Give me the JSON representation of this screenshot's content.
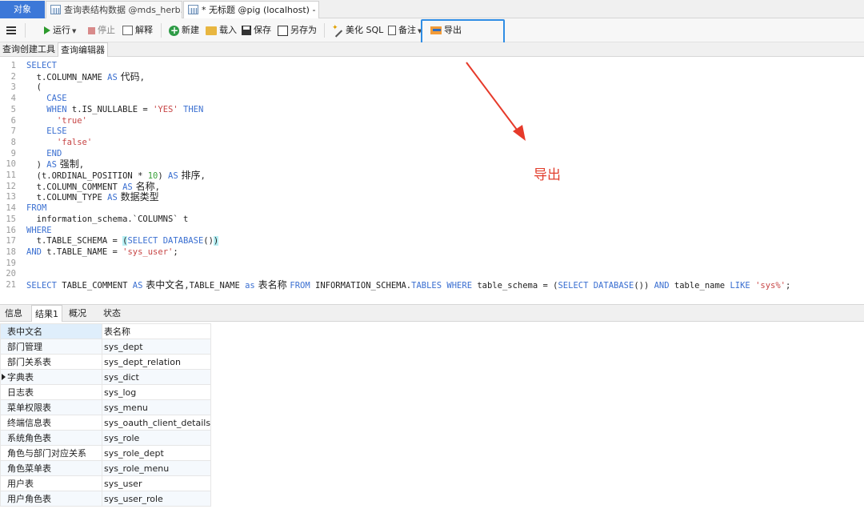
{
  "tabs": {
    "objects": "对象",
    "doc1": "查询表结构数据 @mds_herb...",
    "doc2": "* 无标题 @pig (localhost) - ..."
  },
  "toolbar": {
    "run": "运行",
    "stop": "停止",
    "explain": "解释",
    "new": "新建",
    "load": "载入",
    "save": "保存",
    "save_as": "另存为",
    "beautify": "美化 SQL",
    "note": "备注",
    "export": "导出"
  },
  "subtabs": [
    "查询创建工具",
    "查询编辑器"
  ],
  "annotation": {
    "text": "导出",
    "color": "#e2402f"
  },
  "result_tabs": [
    "信息",
    "结果1",
    "概况",
    "状态"
  ],
  "grid": {
    "columns": [
      "表中文名",
      "表名称"
    ],
    "rows": [
      [
        "部门管理",
        "sys_dept"
      ],
      [
        "部门关系表",
        "sys_dept_relation"
      ],
      [
        "字典表",
        "sys_dict"
      ],
      [
        "日志表",
        "sys_log"
      ],
      [
        "菜单权限表",
        "sys_menu"
      ],
      [
        "终端信息表",
        "sys_oauth_client_details"
      ],
      [
        "系统角色表",
        "sys_role"
      ],
      [
        "角色与部门对应关系",
        "sys_role_dept"
      ],
      [
        "角色菜单表",
        "sys_role_menu"
      ],
      [
        "用户表",
        "sys_user"
      ],
      [
        "用户角色表",
        "sys_user_role"
      ]
    ]
  },
  "editor": {
    "lines": [
      [
        [
          "kw",
          "SELECT"
        ]
      ],
      [
        [
          "t",
          "  t.COLUMN_NAME "
        ],
        [
          "kw",
          "AS"
        ],
        [
          "cjk",
          " 代码"
        ],
        [
          "t",
          ","
        ]
      ],
      [
        [
          "t",
          "  ("
        ]
      ],
      [
        [
          "t",
          "    "
        ],
        [
          "kw",
          "CASE"
        ]
      ],
      [
        [
          "t",
          "    "
        ],
        [
          "kw",
          "WHEN"
        ],
        [
          "t",
          " t.IS_NULLABLE = "
        ],
        [
          "str",
          "'YES'"
        ],
        [
          "t",
          " "
        ],
        [
          "kw",
          "THEN"
        ]
      ],
      [
        [
          "t",
          "      "
        ],
        [
          "str",
          "'true'"
        ]
      ],
      [
        [
          "t",
          "    "
        ],
        [
          "kw",
          "ELSE"
        ]
      ],
      [
        [
          "t",
          "      "
        ],
        [
          "str",
          "'false'"
        ]
      ],
      [
        [
          "t",
          "    "
        ],
        [
          "kw",
          "END"
        ]
      ],
      [
        [
          "t",
          "  ) "
        ],
        [
          "kw",
          "AS"
        ],
        [
          "cjk",
          " 强制"
        ],
        [
          "t",
          ","
        ]
      ],
      [
        [
          "t",
          "  (t.ORDINAL_POSITION * "
        ],
        [
          "num",
          "10"
        ],
        [
          "t",
          ") "
        ],
        [
          "kw",
          "AS"
        ],
        [
          "cjk",
          " 排序"
        ],
        [
          "t",
          ","
        ]
      ],
      [
        [
          "t",
          "  t.COLUMN_COMMENT "
        ],
        [
          "kw",
          "AS"
        ],
        [
          "cjk",
          " 名称"
        ],
        [
          "t",
          ","
        ]
      ],
      [
        [
          "t",
          "  t.COLUMN_TYPE "
        ],
        [
          "kw",
          "AS"
        ],
        [
          "cjk",
          " 数据类型"
        ]
      ],
      [
        [
          "kw",
          "FROM"
        ]
      ],
      [
        [
          "t",
          "  information_schema.`COLUMNS` t"
        ]
      ],
      [
        [
          "kw",
          "WHERE"
        ]
      ],
      [
        [
          "t",
          "  t.TABLE_SCHEMA = "
        ],
        [
          "hl",
          "("
        ],
        [
          "kw",
          "SELECT DATABASE"
        ],
        [
          "t",
          "()"
        ],
        [
          "hl",
          ")"
        ]
      ],
      [
        [
          "kw",
          "AND"
        ],
        [
          "t",
          " t.TABLE_NAME = "
        ],
        [
          "str",
          "'sys_user'"
        ],
        [
          "t",
          ";"
        ]
      ],
      [],
      [],
      [
        [
          "kw",
          "SELECT"
        ],
        [
          "t",
          " TABLE_COMMENT "
        ],
        [
          "kw",
          "AS"
        ],
        [
          "cjk",
          " 表中文名"
        ],
        [
          "t",
          ",TABLE_NAME "
        ],
        [
          "kw",
          "as"
        ],
        [
          "cjk",
          " 表名称 "
        ],
        [
          "kw",
          "FROM"
        ],
        [
          "t",
          " INFORMATION_SCHEMA."
        ],
        [
          "kw",
          "TABLES"
        ],
        [
          "t",
          " "
        ],
        [
          "kw",
          "WHERE"
        ],
        [
          "t",
          " table_schema = ("
        ],
        [
          "kw",
          "SELECT DATABASE"
        ],
        [
          "t",
          "()) "
        ],
        [
          "kw",
          "AND"
        ],
        [
          "t",
          " table_name "
        ],
        [
          "kw",
          "LIKE"
        ],
        [
          "t",
          " "
        ],
        [
          "str",
          "'sys%'"
        ],
        [
          "t",
          ";"
        ]
      ]
    ]
  }
}
